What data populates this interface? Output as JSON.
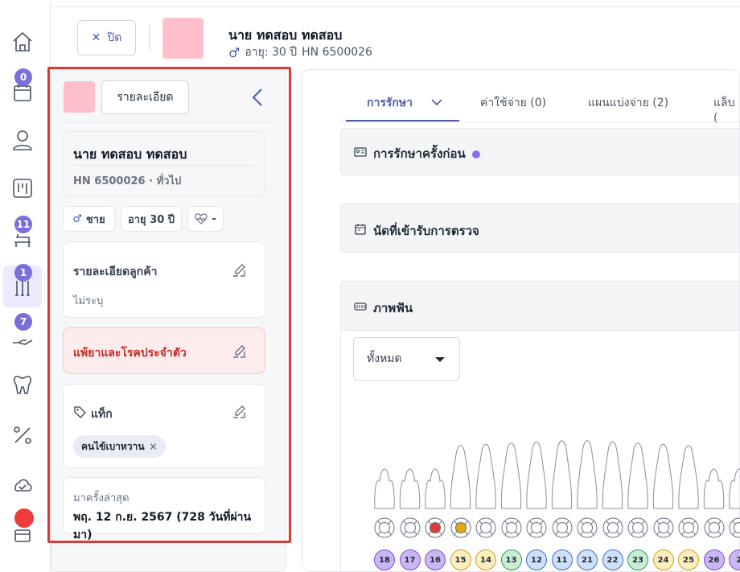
{
  "header": {
    "close_label": "ปิด",
    "patient_name": "นาย ทดสอบ ทดสอบ",
    "age_label": "อายุ: 30 ปี",
    "hn_label": "HN 6500026"
  },
  "rail": {
    "items": [
      {
        "icon": "home-icon",
        "badge": ""
      },
      {
        "icon": "calendar-icon",
        "badge": "0"
      },
      {
        "icon": "user-icon",
        "badge": ""
      },
      {
        "icon": "board-icon",
        "badge": ""
      },
      {
        "icon": "dental-chair-icon",
        "badge": "11"
      },
      {
        "icon": "dental-tools-icon",
        "badge": "1"
      },
      {
        "icon": "hand-coin-icon",
        "badge": "7"
      },
      {
        "icon": "tooth-icon",
        "badge": ""
      },
      {
        "icon": "percent-icon",
        "badge": ""
      },
      {
        "icon": "cloud-check-icon",
        "badge": ""
      },
      {
        "icon": "package-icon",
        "badge": ""
      }
    ]
  },
  "panel": {
    "detail_button": "รายละเอียด",
    "name": "นาย ทดสอบ ทดสอบ",
    "hn_type": "HN 6500026 · ทั่วไป",
    "gender_chip": "ชาย",
    "age_chip": "อายุ 30 ปี",
    "vital_chip": "-",
    "customer_detail_title": "รายละเอียดลูกค้า",
    "customer_detail_value": "ไม่ระบุ",
    "allergy_title": "แพ้ยาและโรคประจำตัว",
    "tags_title": "แท็ก",
    "tag_item": "คนไข้เบาหวาน",
    "last_visit_label": "มาครั้งล่าสุด",
    "last_visit_value": "พฤ. 12 ก.ย. 2567 (728 วันที่ผ่านมา)"
  },
  "tabs": [
    {
      "label": "การรักษา",
      "active": true
    },
    {
      "label": "ค่าใช้จ่าย (0)",
      "active": false
    },
    {
      "label": "แผนแบ่งจ่าย (2)",
      "active": false
    },
    {
      "label": "แล็บ (",
      "active": false
    }
  ],
  "sections": {
    "previous_treatment": "การรักษาครั้งก่อน",
    "appointments": "นัดที่เข้ารับการตรวจ",
    "dental_chart": "ภาพฟัน"
  },
  "filter": {
    "selected": "ทั้งหมด"
  },
  "teeth": [
    {
      "num": "18",
      "color": "#c9b6f2",
      "border": "#7c4fd6"
    },
    {
      "num": "17",
      "color": "#c9b6f2",
      "border": "#7c4fd6"
    },
    {
      "num": "16",
      "color": "#c9b6f2",
      "border": "#7c4fd6",
      "mark": "#e53935"
    },
    {
      "num": "15",
      "color": "#fbeec0",
      "border": "#d4a017",
      "mark": "#e0a800"
    },
    {
      "num": "14",
      "color": "#fbeec0",
      "border": "#d4a017"
    },
    {
      "num": "13",
      "color": "#c9ecd5",
      "border": "#2e9e5b"
    },
    {
      "num": "12",
      "color": "#cfe0f7",
      "border": "#3b6fc2"
    },
    {
      "num": "11",
      "color": "#cfe0f7",
      "border": "#3b6fc2"
    },
    {
      "num": "21",
      "color": "#cfe0f7",
      "border": "#3b6fc2"
    },
    {
      "num": "22",
      "color": "#cfe0f7",
      "border": "#3b6fc2"
    },
    {
      "num": "23",
      "color": "#c9ecd5",
      "border": "#2e9e5b"
    },
    {
      "num": "24",
      "color": "#fbeec0",
      "border": "#d4a017"
    },
    {
      "num": "25",
      "color": "#fbeec0",
      "border": "#d4a017"
    },
    {
      "num": "26",
      "color": "#c9b6f2",
      "border": "#7c4fd6"
    },
    {
      "num": "2",
      "color": "#c9b6f2",
      "border": "#7c4fd6"
    }
  ],
  "colors": {
    "accent": "#4a5aa8",
    "badge": "#7c6fd9",
    "highlight": "#d93a3a",
    "avatar": "#ffbfca"
  }
}
